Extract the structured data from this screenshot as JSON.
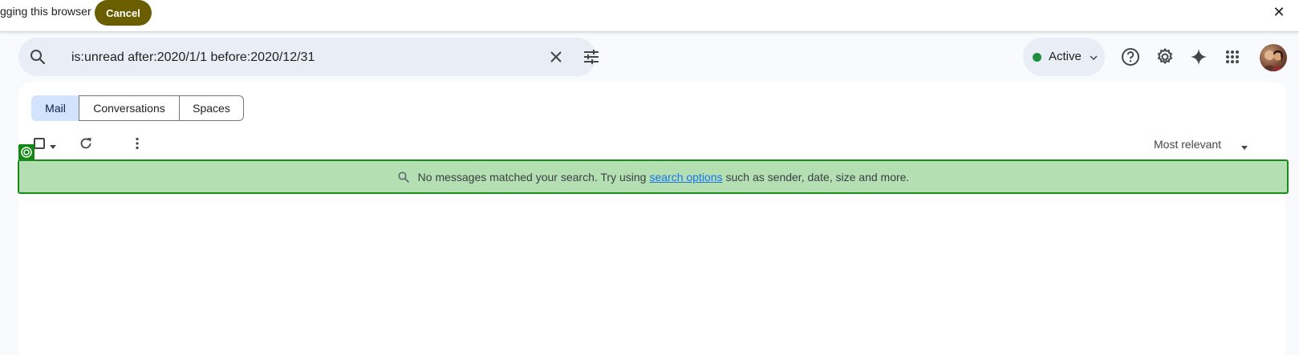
{
  "debug_bar": {
    "text": "gging this browser",
    "cancel_label": "Cancel",
    "close_glyph": "✕"
  },
  "search": {
    "query": "is:unread after:2020/1/1 before:2020/12/31",
    "icons": [
      "search-icon",
      "clear-icon",
      "tune-icon"
    ]
  },
  "status": {
    "label": "Active",
    "color": "#1e8e3e"
  },
  "top_icons": [
    "help-icon",
    "settings-icon",
    "gemini-sparkle-icon",
    "apps-grid-icon",
    "avatar"
  ],
  "tabs": [
    {
      "label": "Mail",
      "selected": true
    },
    {
      "label": "Conversations",
      "selected": false
    },
    {
      "label": "Spaces",
      "selected": false
    }
  ],
  "toolbar": {
    "sort_label": "Most relevant"
  },
  "empty_state": {
    "prefix": "No messages matched your search. Try using",
    "link": "search options",
    "suffix": "such as sender, date, size and more."
  },
  "colors": {
    "accent_blue": "#d3e3fd",
    "banner_bg": "#b3dfb3",
    "banner_border": "#1a8a1a",
    "cancel_bg": "#6b5e00"
  }
}
